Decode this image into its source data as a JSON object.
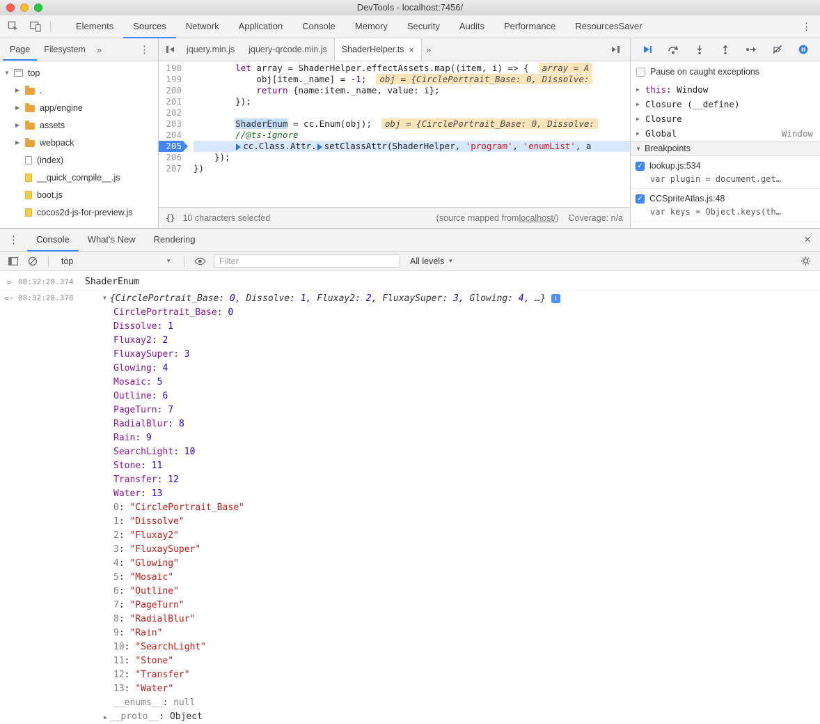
{
  "window": {
    "title": "DevTools - localhost:7456/"
  },
  "colors": {
    "accent_blue": "#4285f4",
    "traffic_close": "#ff5f57",
    "traffic_minimize": "#febc2e",
    "traffic_zoom": "#28c840",
    "keyword": "#770088",
    "string": "#c41a16",
    "number": "#1c00cf",
    "comment": "#236e25",
    "property_key": "#881391",
    "exec_line_bg": "#d8e7fb",
    "inline_value_bg": "#fbe3ba"
  },
  "icons": {
    "kebab": "⋮",
    "more_tabs": "»",
    "close": "×",
    "dropdown": "▼",
    "collapsed": "▶",
    "expanded": "▼",
    "pretty_print": "{}",
    "command_chevron": ">",
    "result_chevron": "<·",
    "info": "i"
  },
  "toolbar": {
    "tabs": [
      {
        "label": "Elements"
      },
      {
        "label": "Sources",
        "active": true
      },
      {
        "label": "Network"
      },
      {
        "label": "Application"
      },
      {
        "label": "Console"
      },
      {
        "label": "Memory"
      },
      {
        "label": "Security"
      },
      {
        "label": "Audits"
      },
      {
        "label": "Performance"
      },
      {
        "label": "ResourcesSaver"
      }
    ]
  },
  "navigator": {
    "tabs": [
      {
        "label": "Page",
        "active": true
      },
      {
        "label": "Filesystem"
      }
    ],
    "tree": [
      {
        "label": "top",
        "icon": "frame",
        "disclosure": "expanded",
        "level": 0
      },
      {
        "label": ".",
        "icon": "folder",
        "disclosure": "collapsed",
        "level": 1
      },
      {
        "label": "app/engine",
        "icon": "folder",
        "disclosure": "collapsed",
        "level": 1
      },
      {
        "label": "assets",
        "icon": "folder",
        "disclosure": "collapsed",
        "level": 1
      },
      {
        "label": "webpack",
        "icon": "folder",
        "disclosure": "collapsed",
        "level": 1
      },
      {
        "label": "(index)",
        "icon": "doc",
        "level": 1
      },
      {
        "label": "__quick_compile__.js",
        "icon": "js",
        "level": 1
      },
      {
        "label": "boot.js",
        "icon": "js",
        "level": 1
      },
      {
        "label": "cocos2d-js-for-preview.js",
        "icon": "js",
        "level": 1
      }
    ]
  },
  "editor": {
    "tabs": [
      {
        "label": "jquery.min.js"
      },
      {
        "label": "jquery-qrcode.min.js"
      },
      {
        "label": "ShaderHelper.ts",
        "active": true,
        "closable": true
      }
    ],
    "lines": [
      {
        "no": 198,
        "tokens": [
          {
            "c": "p",
            "t": "        "
          },
          {
            "c": "k",
            "t": "let"
          },
          {
            "c": "p",
            "t": " array = ShaderHelper.effectAssets.map((item, i) => {"
          },
          {
            "c": "w",
            "t": "array = A"
          }
        ]
      },
      {
        "no": 199,
        "tokens": [
          {
            "c": "p",
            "t": "            obj[item._name] = "
          },
          {
            "c": "n",
            "t": "-1"
          },
          {
            "c": "p",
            "t": ";"
          },
          {
            "c": "w",
            "t": "obj = {CirclePortrait_Base: 0, Dissolve:"
          }
        ]
      },
      {
        "no": 200,
        "tokens": [
          {
            "c": "p",
            "t": "            "
          },
          {
            "c": "k",
            "t": "return"
          },
          {
            "c": "p",
            "t": " {name:item._name, value: i};"
          }
        ]
      },
      {
        "no": 201,
        "tokens": [
          {
            "c": "p",
            "t": "        });"
          }
        ]
      },
      {
        "no": 202,
        "tokens": []
      },
      {
        "no": 203,
        "tokens": [
          {
            "c": "p",
            "t": "        "
          },
          {
            "c": "sel",
            "t": "ShaderEnum"
          },
          {
            "c": "p",
            "t": " = cc.Enum(obj);"
          },
          {
            "c": "w",
            "t": "obj = {CirclePortrait_Base: 0, Dissolve:"
          }
        ]
      },
      {
        "no": 204,
        "tokens": [
          {
            "c": "p",
            "t": "        "
          },
          {
            "c": "c",
            "t": "//@ts-ignore"
          }
        ]
      },
      {
        "no": 205,
        "exec": true,
        "bp": true,
        "tokens": [
          {
            "c": "p",
            "t": "        "
          },
          {
            "c": "m",
            "t": ""
          },
          {
            "c": "p",
            "t": "cc.Class.Attr."
          },
          {
            "c": "m",
            "t": ""
          },
          {
            "c": "p",
            "t": "setClassAttr(ShaderHelper, "
          },
          {
            "c": "s",
            "t": "'program'"
          },
          {
            "c": "p",
            "t": ", "
          },
          {
            "c": "s",
            "t": "'enumList'"
          },
          {
            "c": "p",
            "t": ", a"
          }
        ]
      },
      {
        "no": 206,
        "tokens": [
          {
            "c": "p",
            "t": "    });"
          }
        ]
      },
      {
        "no": 207,
        "tokens": [
          {
            "c": "p",
            "t": "})"
          }
        ]
      }
    ],
    "status": {
      "selection": "10 characters selected",
      "mapped_prefix": "(source mapped from ",
      "mapped_link": "localhost/",
      "mapped_suffix": ")",
      "coverage": "Coverage: n/a"
    }
  },
  "debugger_pane": {
    "pause_on_caught": "Pause on caught exceptions",
    "scope": [
      {
        "name": "this",
        "name_class": "this",
        "sep": ": ",
        "value": "Window"
      },
      {
        "name": "Closure",
        "sep": " ",
        "value": "(__define)"
      },
      {
        "name": "Closure"
      },
      {
        "name": "Global",
        "value_right": "Window"
      }
    ],
    "breakpoints_title": "Breakpoints",
    "breakpoints": [
      {
        "checked": true,
        "label": "lookup.js:534",
        "snippet": "var plugin = document.get…"
      },
      {
        "checked": true,
        "label": "CCSpriteAtlas.js:48",
        "snippet": "var keys = Object.keys(th…"
      }
    ]
  },
  "drawer": {
    "tabs": [
      {
        "label": "Console",
        "active": true
      },
      {
        "label": "What's New"
      },
      {
        "label": "Rendering"
      }
    ]
  },
  "console": {
    "context": "top",
    "filter_placeholder": "Filter",
    "levels": "All levels",
    "messages": [
      {
        "type": "command",
        "time": "08:32:28.374",
        "text": "ShaderEnum"
      },
      {
        "type": "result",
        "time": "08:32:28.378",
        "preview": [
          {
            "c": "b",
            "t": "{"
          },
          {
            "c": "k",
            "t": "CirclePortrait_Base"
          },
          {
            "c": "b",
            "t": ": "
          },
          {
            "c": "n",
            "t": "0"
          },
          {
            "c": "b",
            "t": ", "
          },
          {
            "c": "k",
            "t": "Dissolve"
          },
          {
            "c": "b",
            "t": ": "
          },
          {
            "c": "n",
            "t": "1"
          },
          {
            "c": "b",
            "t": ", "
          },
          {
            "c": "k",
            "t": "Fluxay2"
          },
          {
            "c": "b",
            "t": ": "
          },
          {
            "c": "n",
            "t": "2"
          },
          {
            "c": "b",
            "t": ", "
          },
          {
            "c": "k",
            "t": "FluxaySuper"
          },
          {
            "c": "b",
            "t": ": "
          },
          {
            "c": "n",
            "t": "3"
          },
          {
            "c": "b",
            "t": ", "
          },
          {
            "c": "k",
            "t": "Glowing"
          },
          {
            "c": "b",
            "t": ": "
          },
          {
            "c": "n",
            "t": "4"
          },
          {
            "c": "b",
            "t": ", …}"
          }
        ]
      }
    ],
    "properties": [
      {
        "key": "CirclePortrait_Base",
        "key_class": "enum",
        "value": "0",
        "value_class": "num"
      },
      {
        "key": "Dissolve",
        "key_class": "enum",
        "value": "1",
        "value_class": "num"
      },
      {
        "key": "Fluxay2",
        "key_class": "enum",
        "value": "2",
        "value_class": "num"
      },
      {
        "key": "FluxaySuper",
        "key_class": "enum",
        "value": "3",
        "value_class": "num"
      },
      {
        "key": "Glowing",
        "key_class": "enum",
        "value": "4",
        "value_class": "num"
      },
      {
        "key": "Mosaic",
        "key_class": "enum",
        "value": "5",
        "value_class": "num"
      },
      {
        "key": "Outline",
        "key_class": "enum",
        "value": "6",
        "value_class": "num"
      },
      {
        "key": "PageTurn",
        "key_class": "enum",
        "value": "7",
        "value_class": "num"
      },
      {
        "key": "RadialBlur",
        "key_class": "enum",
        "value": "8",
        "value_class": "num"
      },
      {
        "key": "Rain",
        "key_class": "enum",
        "value": "9",
        "value_class": "num"
      },
      {
        "key": "SearchLight",
        "key_class": "enum",
        "value": "10",
        "value_class": "num"
      },
      {
        "key": "Stone",
        "key_class": "enum",
        "value": "11",
        "value_class": "num"
      },
      {
        "key": "Transfer",
        "key_class": "enum",
        "value": "12",
        "value_class": "num"
      },
      {
        "key": "Water",
        "key_class": "enum",
        "value": "13",
        "value_class": "num"
      },
      {
        "key": "0",
        "key_class": "dim",
        "value": "\"CirclePortrait_Base\"",
        "value_class": "str"
      },
      {
        "key": "1",
        "key_class": "dim",
        "value": "\"Dissolve\"",
        "value_class": "str"
      },
      {
        "key": "2",
        "key_class": "dim",
        "value": "\"Fluxay2\"",
        "value_class": "str"
      },
      {
        "key": "3",
        "key_class": "dim",
        "value": "\"FluxaySuper\"",
        "value_class": "str"
      },
      {
        "key": "4",
        "key_class": "dim",
        "value": "\"Glowing\"",
        "value_class": "str"
      },
      {
        "key": "5",
        "key_class": "dim",
        "value": "\"Mosaic\"",
        "value_class": "str"
      },
      {
        "key": "6",
        "key_class": "dim",
        "value": "\"Outline\"",
        "value_class": "str"
      },
      {
        "key": "7",
        "key_class": "dim",
        "value": "\"PageTurn\"",
        "value_class": "str"
      },
      {
        "key": "8",
        "key_class": "dim",
        "value": "\"RadialBlur\"",
        "value_class": "str"
      },
      {
        "key": "9",
        "key_class": "dim",
        "value": "\"Rain\"",
        "value_class": "str"
      },
      {
        "key": "10",
        "key_class": "dim",
        "value": "\"SearchLight\"",
        "value_class": "str"
      },
      {
        "key": "11",
        "key_class": "dim",
        "value": "\"Stone\"",
        "value_class": "str"
      },
      {
        "key": "12",
        "key_class": "dim",
        "value": "\"Transfer\"",
        "value_class": "str"
      },
      {
        "key": "13",
        "key_class": "dim",
        "value": "\"Water\"",
        "value_class": "str"
      },
      {
        "key": "__enums__",
        "key_class": "dim",
        "value": "null",
        "value_class": "null"
      },
      {
        "key": "__proto__",
        "key_class": "dim",
        "value": "Object",
        "value_class": "obj",
        "expandable": true
      }
    ]
  }
}
